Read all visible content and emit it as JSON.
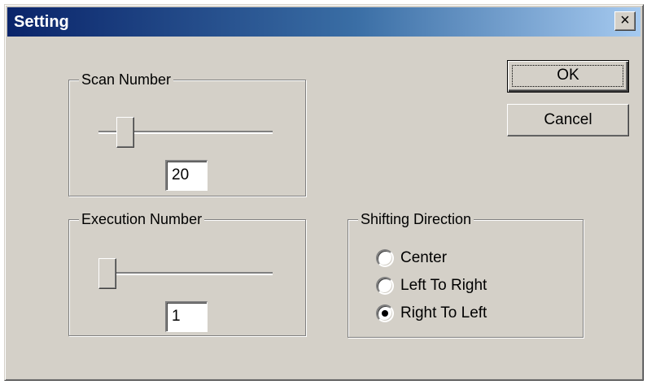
{
  "dialog": {
    "title": "Setting",
    "close_label": "×"
  },
  "scan": {
    "legend": "Scan Number",
    "value": "20"
  },
  "execution": {
    "legend": "Execution Number",
    "value": "1"
  },
  "shifting": {
    "legend": "Shifting Direction",
    "options": [
      {
        "label": "Center",
        "selected": false
      },
      {
        "label": "Left To Right",
        "selected": false
      },
      {
        "label": "Right To Left",
        "selected": true
      }
    ]
  },
  "buttons": {
    "ok": "OK",
    "cancel": "Cancel"
  },
  "colors": {
    "title_start": "#0a246a",
    "title_end": "#a6caf0",
    "face": "#d4d0c8"
  },
  "icons": {
    "close": "close-icon",
    "radio": "radio-icon"
  }
}
